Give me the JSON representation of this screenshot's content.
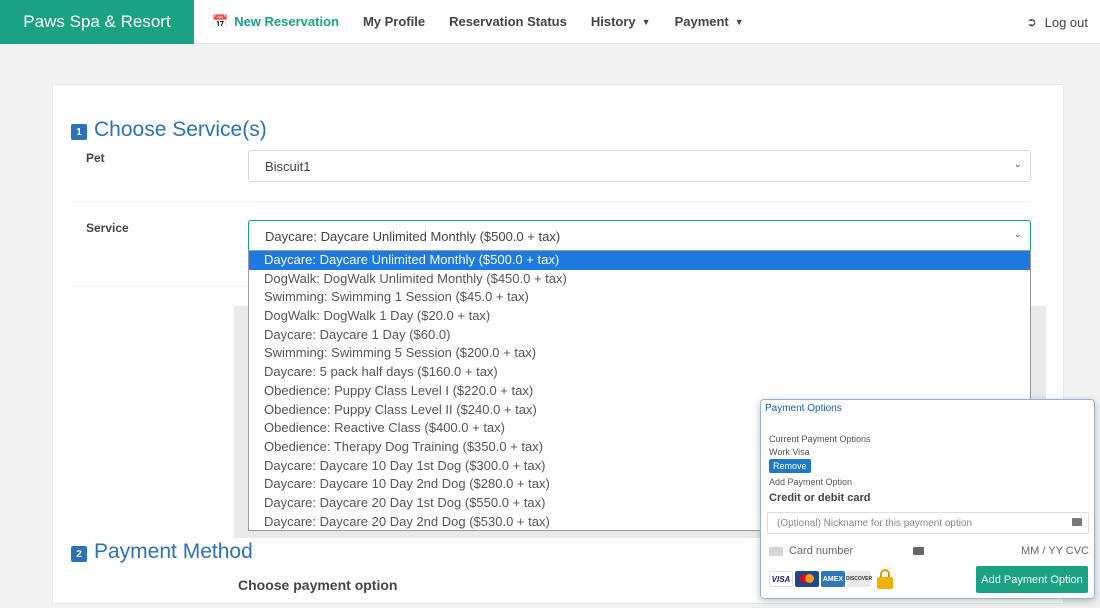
{
  "navbar": {
    "brand": "Paws Spa & Resort",
    "items": [
      {
        "label": "New Reservation",
        "icon": "calendar-icon",
        "active": true
      },
      {
        "label": "My Profile"
      },
      {
        "label": "Reservation Status"
      },
      {
        "label": "History",
        "dropdown": true
      },
      {
        "label": "Payment",
        "dropdown": true
      }
    ],
    "logout": "Log out"
  },
  "section1": {
    "number": "1",
    "title": "Choose Service(s)",
    "pet_label": "Pet",
    "pet_value": "Biscuit1",
    "service_label": "Service",
    "service_value": "Daycare: Daycare Unlimited Monthly ($500.0 + tax)"
  },
  "service_options": [
    "Daycare: Daycare Unlimited Monthly ($500.0 + tax)",
    "DogWalk: DogWalk Unlimited Monthly ($450.0 + tax)",
    "Swimming: Swimming 1 Session ($45.0 + tax)",
    "DogWalk: DogWalk 1 Day ($20.0 + tax)",
    "Daycare: Daycare 1 Day ($60.0)",
    "Swimming: Swimming 5 Session ($200.0 + tax)",
    "Daycare: 5 pack half days ($160.0 + tax)",
    "Obedience: Puppy Class Level I ($220.0 + tax)",
    "Obedience: Puppy Class Level II ($240.0 + tax)",
    "Obedience: Reactive Class ($400.0 + tax)",
    "Obedience: Therapy Dog Training ($350.0 + tax)",
    "Daycare: Daycare 10 Day 1st Dog ($300.0 + tax)",
    "Daycare: Daycare 10 Day 2nd Dog ($280.0 + tax)",
    "Daycare: Daycare 20 Day 1st Dog ($550.0 + tax)",
    "Daycare: Daycare 20 Day 2nd Dog ($530.0 + tax)"
  ],
  "section2": {
    "number": "2",
    "title": "Payment Method",
    "choose_option": "Choose payment option"
  },
  "payment_popup": {
    "title": "Payment Options",
    "current_label": "Current Payment Options",
    "current_card": "Work Visa",
    "remove_label": "Remove",
    "add_label": "Add Payment Option",
    "card_heading": "Credit or debit card",
    "nickname_placeholder": "(Optional) Nickname for this payment option",
    "card_number_placeholder": "Card number",
    "expiry_cvc_placeholder": "MM / YY  CVC",
    "card_logos": [
      "VISA",
      "mastercard",
      "AMEX",
      "DISCOVER"
    ],
    "add_button": "Add Payment Option"
  },
  "colors": {
    "brand": "#1aa283",
    "accent_blue": "#2a72b5",
    "selected_option": "#1e79e0"
  }
}
